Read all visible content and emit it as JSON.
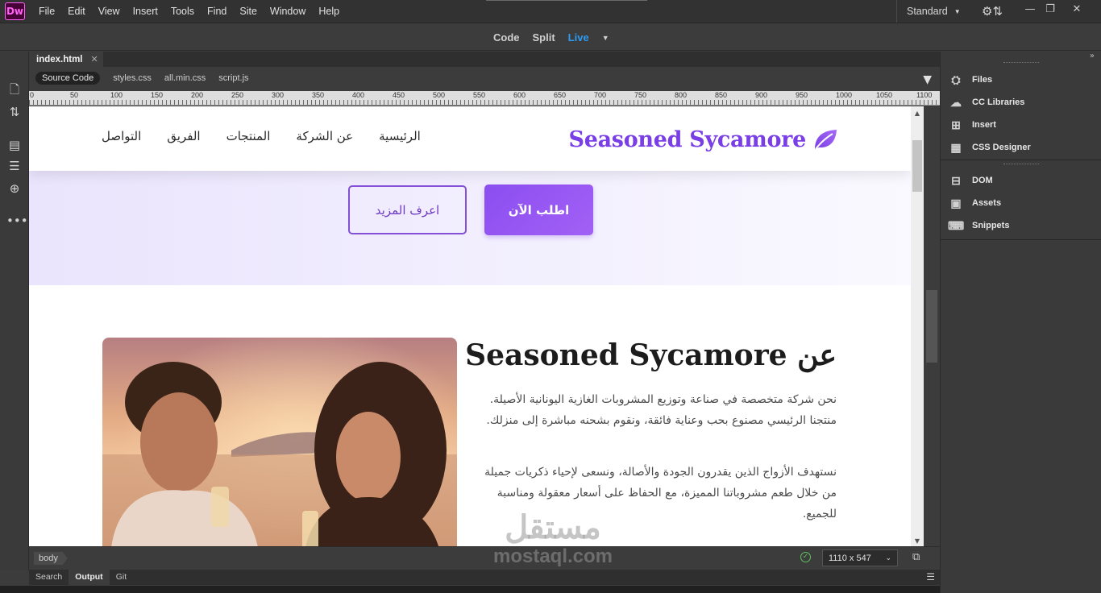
{
  "app": {
    "logo": "Dw",
    "menu": [
      "File",
      "Edit",
      "View",
      "Insert",
      "Tools",
      "Find",
      "Site",
      "Window",
      "Help"
    ],
    "workspace": "Standard"
  },
  "views": {
    "code": "Code",
    "split": "Split",
    "live": "Live"
  },
  "document": {
    "tab": "index.html",
    "related_files": [
      "Source Code",
      "styles.css",
      "all.min.css",
      "script.js"
    ]
  },
  "ruler": {
    "labels": [
      "0",
      "50",
      "100",
      "150",
      "200",
      "250",
      "300",
      "350",
      "400",
      "450",
      "500",
      "550",
      "600",
      "650",
      "700",
      "750",
      "800",
      "850",
      "900",
      "950",
      "1000",
      "1050",
      "1100"
    ]
  },
  "site": {
    "brand": "Seasoned Sycamore",
    "nav": [
      "الرئيسية",
      "عن الشركة",
      "المنتجات",
      "الفريق",
      "التواصل"
    ],
    "hero": {
      "primary_button": "اطلب الآن",
      "secondary_button": "اعرف المزيد"
    },
    "about": {
      "title": "عن Seasoned Sycamore",
      "p1": "نحن شركة متخصصة في صناعة وتوزيع المشروبات الغازية اليونانية الأصيلة. منتجنا الرئيسي مصنوع بحب وعناية فائقة، ونقوم بشحنه مباشرة إلى منزلك.",
      "p2": "نستهدف الأزواج الذين يقدرون الجودة والأصالة، ونسعى لإحياء ذكريات جميلة من خلال طعم مشروباتنا المميزة، مع الحفاظ على أسعار معقولة ومناسبة للجميع."
    }
  },
  "status": {
    "tag": "body",
    "viewport_size": "1110 x 547"
  },
  "bottom_tabs": [
    "Search",
    "Output",
    "Git"
  ],
  "panels": {
    "group1": [
      "Files",
      "CC Libraries",
      "Insert",
      "CSS Designer"
    ],
    "group2": [
      "DOM",
      "Assets",
      "Snippets"
    ]
  },
  "watermark": {
    "arabic": "مستقل",
    "latin": "mostaql.com"
  },
  "colors": {
    "brand": "#7a3ee6",
    "live_active": "#2d9bf0",
    "dw_logo_bg": "#470137",
    "dw_logo_fg": "#ff61f6"
  }
}
